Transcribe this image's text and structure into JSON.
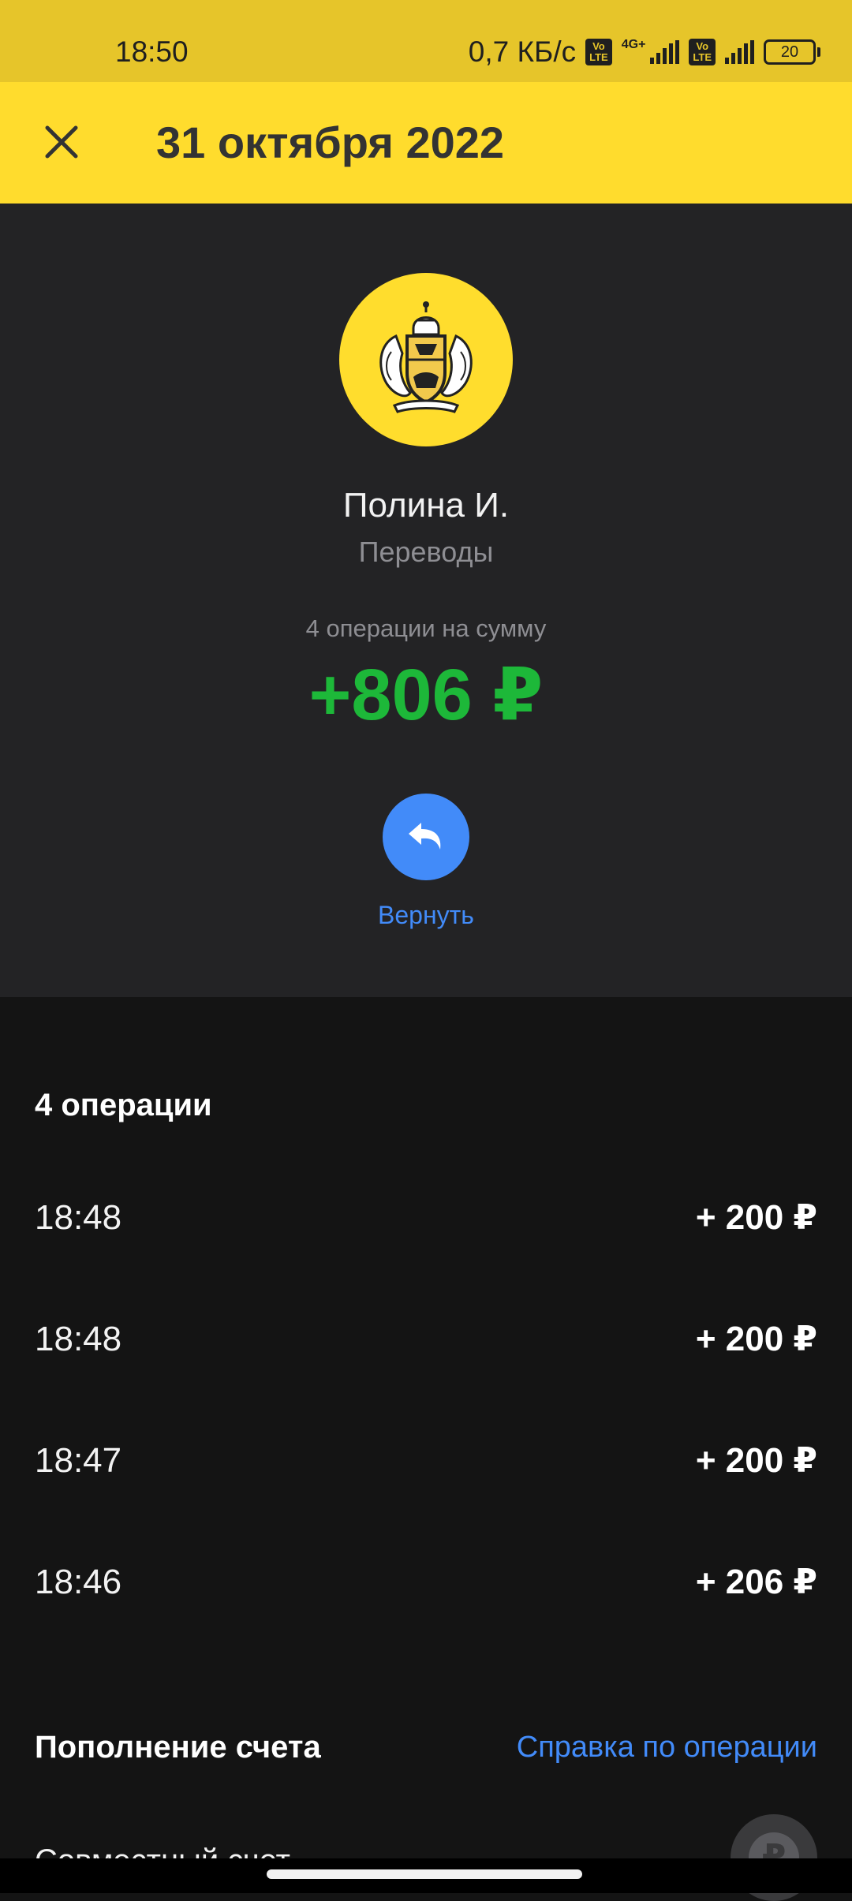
{
  "status_bar": {
    "time": "18:50",
    "net_speed": "0,7 КБ/с",
    "volte_label": "Vo LTE",
    "network_type": "4G+",
    "battery": "20"
  },
  "header": {
    "close_icon": "close-icon",
    "title": "31 октября 2022"
  },
  "summary": {
    "avatar_icon": "tinkoff-bank-crest-logo",
    "counterparty": "Полина И.",
    "category": "Переводы",
    "operations_summary": "4 операции на сумму",
    "total": "+806 ₽",
    "refund_icon": "return-arrow-icon",
    "refund_label": "Вернуть"
  },
  "operations": {
    "title": "4 операции",
    "items": [
      {
        "time": "18:48",
        "amount": "+ 200 ₽"
      },
      {
        "time": "18:48",
        "amount": "+ 200 ₽"
      },
      {
        "time": "18:47",
        "amount": "+ 200 ₽"
      },
      {
        "time": "18:46",
        "amount": "+ 206 ₽"
      }
    ]
  },
  "details": {
    "title": "Пополнение счета",
    "help_link": "Справка по операции",
    "account_partial": "Совместный счет",
    "account_icon": "ruble-coin-icon",
    "account_icon_glyph": "₽"
  },
  "colors": {
    "status_bar_bg": "#e6c52a",
    "header_bg": "#ffdc2d",
    "summary_bg": "#232325",
    "page_bg": "#141414",
    "income_green": "#1db839",
    "accent_blue": "#428bf9",
    "muted_text": "#8e8e93"
  }
}
